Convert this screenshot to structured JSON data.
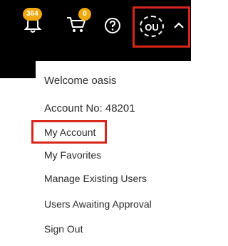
{
  "header": {
    "notifications_count": "364",
    "cart_count": "0",
    "user_initials": "OU",
    "icons": [
      "bell-icon",
      "cart-icon",
      "help-icon",
      "chevron-up-icon"
    ],
    "highlight_color": "#d9261c",
    "badge_color": "#f0a80c"
  },
  "menu": {
    "welcome": "Welcome oasis",
    "account_no": "Account No: 48201",
    "my_account": "My Account",
    "my_favorites": "My Favorites",
    "manage_users": "Manage Existing Users",
    "users_awaiting": "Users Awaiting Approval",
    "sign_out": "Sign Out"
  }
}
